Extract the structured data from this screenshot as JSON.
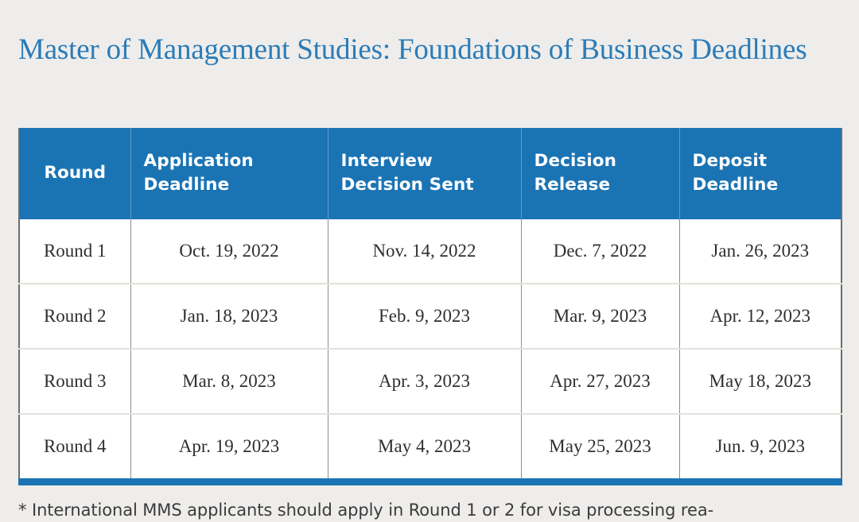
{
  "page": {
    "title": "Master of Management Studies: Foundations of Business Deadlines",
    "background_color": "#eeedeb",
    "title_color": "#2b7cb8",
    "accent_color": "#1a74b4"
  },
  "table": {
    "columns": [
      {
        "key": "round",
        "label": "Round"
      },
      {
        "key": "app",
        "label": "Application Deadline"
      },
      {
        "key": "interview",
        "label": "Interview Decision Sent"
      },
      {
        "key": "decision",
        "label": "Decision Release"
      },
      {
        "key": "deposit",
        "label": "Deposit Deadline"
      }
    ],
    "rows": [
      {
        "round": "Round 1",
        "app": "Oct. 19, 2022",
        "interview": "Nov. 14, 2022",
        "decision": "Dec. 7, 2022",
        "deposit": "Jan. 26, 2023"
      },
      {
        "round": "Round 2",
        "app": "Jan. 18, 2023",
        "interview": "Feb. 9, 2023",
        "decision": "Mar. 9, 2023",
        "deposit": "Apr. 12, 2023"
      },
      {
        "round": "Round 3",
        "app": "Mar. 8, 2023",
        "interview": "Apr. 3, 2023",
        "decision": "Apr. 27, 2023",
        "deposit": "May 18, 2023"
      },
      {
        "round": "Round 4",
        "app": "Apr. 19, 2023",
        "interview": "May 4, 2023",
        "decision": "May 25, 2023",
        "deposit": "Jun. 9, 2023"
      }
    ]
  },
  "footnote": {
    "text": "* International MMS applicants should apply in Round 1 or 2 for visa processing rea-"
  }
}
